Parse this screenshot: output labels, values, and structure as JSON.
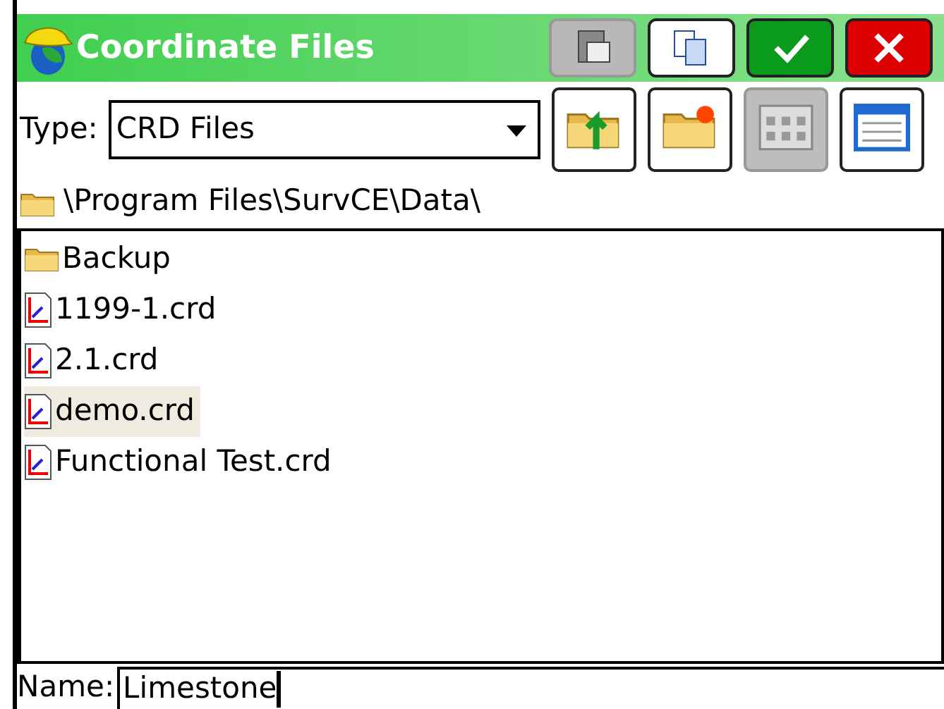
{
  "window": {
    "title": "Coordinate Files"
  },
  "title_buttons": [
    {
      "kind": "paste",
      "disabled": true
    },
    {
      "kind": "copy",
      "disabled": false
    },
    {
      "kind": "ok",
      "disabled": false
    },
    {
      "kind": "cancel",
      "disabled": false
    }
  ],
  "type_label": "Type:",
  "type_value": "CRD Files",
  "tool_buttons": [
    {
      "kind": "up-folder",
      "selected": false
    },
    {
      "kind": "new-folder",
      "selected": false
    },
    {
      "kind": "icon-view",
      "selected": true
    },
    {
      "kind": "list-view",
      "selected": false
    }
  ],
  "path": "\\Program Files\\SurvCE\\Data\\",
  "files": [
    {
      "kind": "folder",
      "name": "Backup",
      "selected": false
    },
    {
      "kind": "file",
      "name": "1199-1.crd",
      "selected": false
    },
    {
      "kind": "file",
      "name": "2.1.crd",
      "selected": false
    },
    {
      "kind": "file",
      "name": "demo.crd",
      "selected": true
    },
    {
      "kind": "file",
      "name": "Functional Test.crd",
      "selected": false
    }
  ],
  "name_label": "Name:",
  "name_value": "Limestone"
}
